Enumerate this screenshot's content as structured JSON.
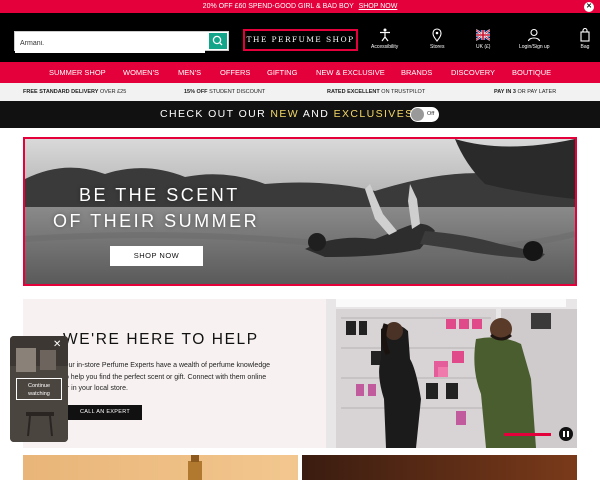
{
  "promo": {
    "text": "20% OFF £60 SPEND-GOOD GIRL & BAD BOY",
    "link": "SHOP NOW",
    "close_icon": "close-icon"
  },
  "header": {
    "search_value": "Armani.",
    "search_icon": "search-icon",
    "logo": "THE PERFUME SHOP",
    "icons": [
      {
        "name": "accessibility-icon",
        "label": "Accessibility"
      },
      {
        "name": "stores-pin-icon",
        "label": "Stores"
      },
      {
        "name": "uk-flag-icon",
        "label": "UK (£)"
      },
      {
        "name": "user-icon",
        "label": "Login/Sign up"
      },
      {
        "name": "bag-icon",
        "label": "Bag"
      }
    ]
  },
  "nav": [
    "SUMMER SHOP",
    "WOMEN'S",
    "MEN'S",
    "OFFERS",
    "GIFTING",
    "NEW & EXCLUSIVE",
    "BRANDS",
    "DISCOVERY",
    "BOUTIQUE"
  ],
  "usp": [
    {
      "bold": "FREE STANDARD DELIVERY",
      "rest": " OVER £25"
    },
    {
      "bold": "15% OFF",
      "rest": " STUDENT DISCOUNT"
    },
    {
      "bold": "RATED EXCELLENT",
      "rest": " ON TRUSTPILOT"
    },
    {
      "bold": "PAY IN 3",
      "rest": " OR PAY LATER"
    }
  ],
  "exclusive": {
    "pre": "CHECK OUT OUR ",
    "new": "NEW",
    "and": " AND ",
    "excl": "EXCLUSIVES",
    "toggle_label": "Off",
    "toggle_on": false
  },
  "hero": {
    "line1": "BE THE SCENT",
    "line2": "OF THEIR SUMMER",
    "button": "SHOP NOW"
  },
  "help": {
    "heading": "WE'RE HERE TO HELP",
    "body": "Our in-store Perfume Experts have a wealth of perfume knowledge to help you find the perfect scent or gift. Connect with them online or in your local store.",
    "button": "CALL AN EXPERT",
    "pause_icon": "pause-icon"
  },
  "video": {
    "label_line1": "Continue",
    "label_line2": "watching",
    "close_icon": "close-icon"
  },
  "colors": {
    "brand_red": "#e4003b",
    "black": "#000000",
    "teal": "#12a589",
    "gold": "#f5d867"
  }
}
